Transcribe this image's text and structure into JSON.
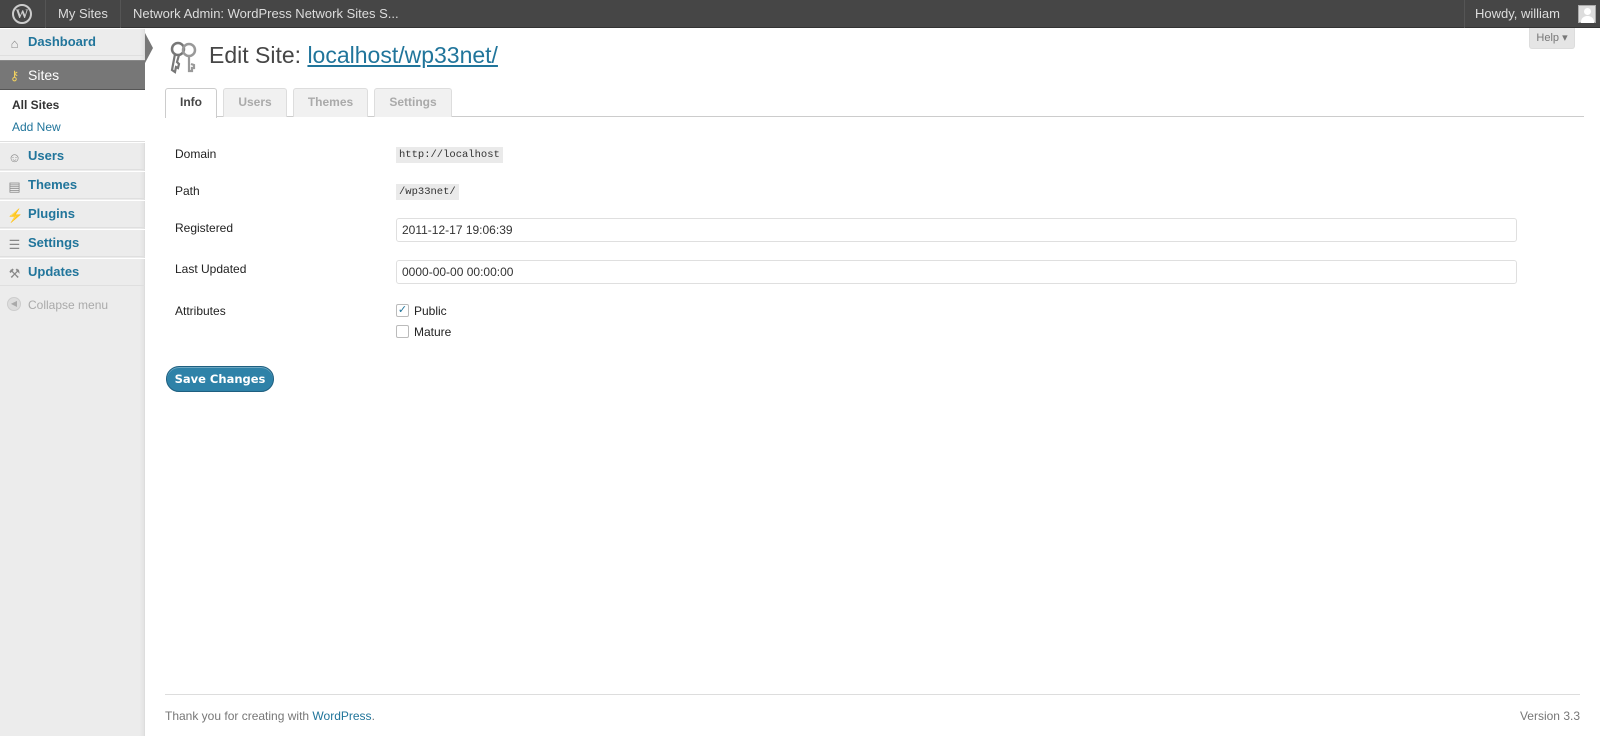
{
  "adminbar": {
    "my_sites": "My Sites",
    "network_title": "Network Admin: WordPress Network Sites S...",
    "howdy": "Howdy, william",
    "logo_icon": "wordpress-logo-icon"
  },
  "sidebar": {
    "items": [
      {
        "label": "Dashboard",
        "icon": "home-icon"
      },
      {
        "label": "Sites",
        "icon": "keys-icon"
      },
      {
        "label": "Users",
        "icon": "users-icon"
      },
      {
        "label": "Themes",
        "icon": "themes-icon"
      },
      {
        "label": "Plugins",
        "icon": "plugin-icon"
      },
      {
        "label": "Settings",
        "icon": "settings-icon"
      },
      {
        "label": "Updates",
        "icon": "tools-icon"
      }
    ],
    "submenu": {
      "all_sites": "All Sites",
      "add_new": "Add New"
    },
    "collapse": "Collapse menu"
  },
  "header": {
    "help": "Help ▾",
    "title_prefix": "Edit Site:",
    "title_link": "localhost/wp33net/"
  },
  "tabs": [
    {
      "label": "Info",
      "active": true
    },
    {
      "label": "Users",
      "active": false
    },
    {
      "label": "Themes",
      "active": false
    },
    {
      "label": "Settings",
      "active": false
    }
  ],
  "form": {
    "domain_label": "Domain",
    "domain_value": "http://localhost",
    "path_label": "Path",
    "path_value": "/wp33net/",
    "registered_label": "Registered",
    "registered_value": "2011-12-17 19:06:39",
    "last_updated_label": "Last Updated",
    "last_updated_value": "0000-00-00 00:00:00",
    "attributes_label": "Attributes",
    "attributes": [
      {
        "label": "Public",
        "checked": true
      },
      {
        "label": "Mature",
        "checked": false
      }
    ]
  },
  "save_button": "Save Changes",
  "footer": {
    "thanks_prefix": "Thank you for creating with",
    "thanks_link": "WordPress",
    "thanks_suffix": ".",
    "version": "Version 3.3"
  },
  "colors": {
    "accent": "#21759b",
    "adminbar": "#464646",
    "active_menu": "#777777",
    "button": "#2e82a8"
  }
}
